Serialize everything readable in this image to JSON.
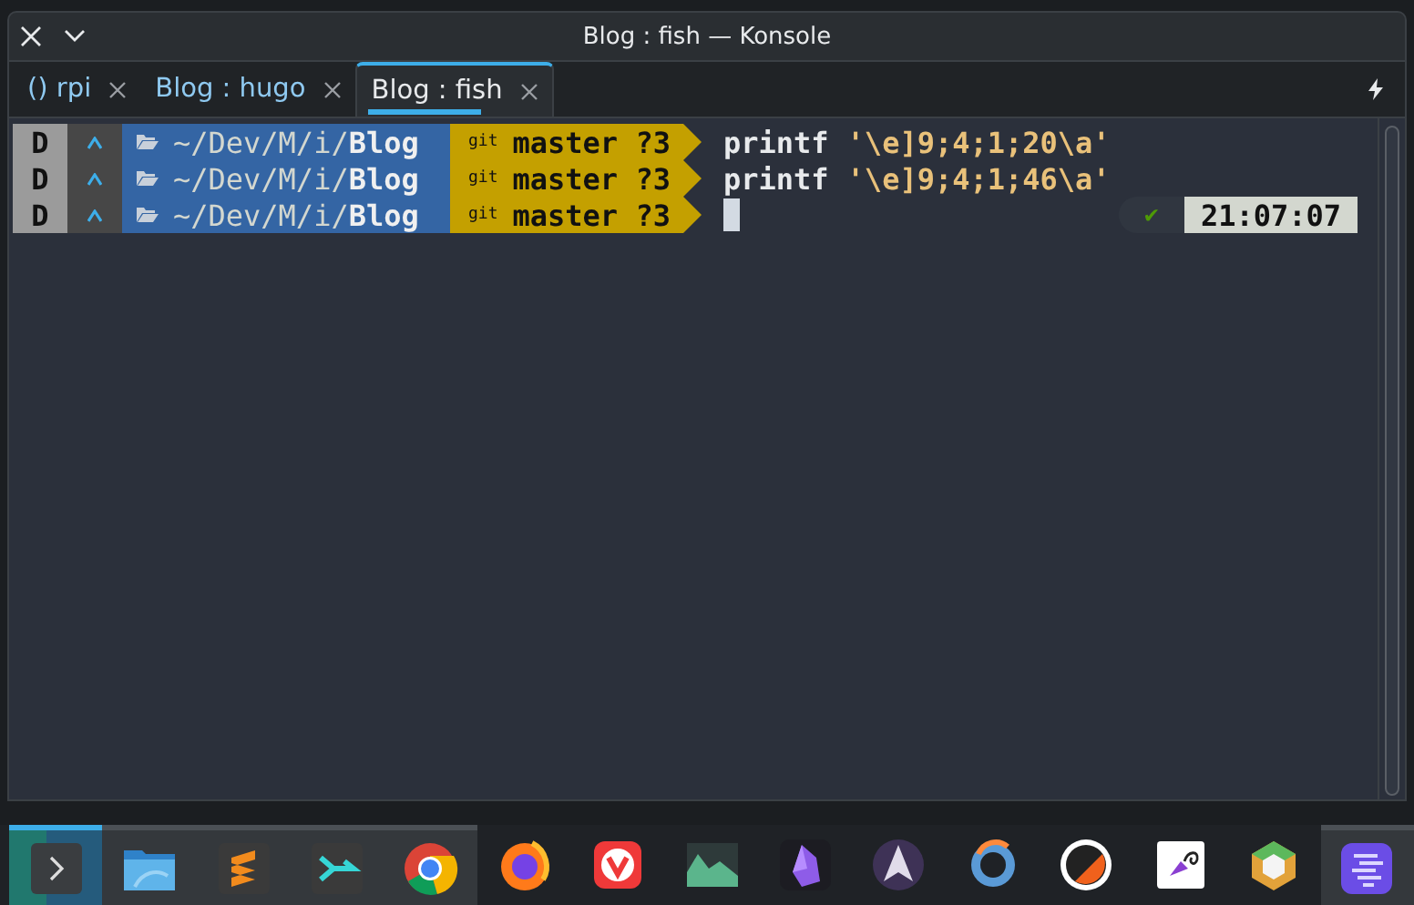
{
  "window": {
    "title": "Blog : fish — Konsole"
  },
  "tabs": [
    {
      "label": "() rpi",
      "selected": false
    },
    {
      "label": "Blog : hugo",
      "selected": false
    },
    {
      "label": "Blog : fish",
      "selected": true
    }
  ],
  "prompt_lines": [
    {
      "status": "D",
      "path": "~/Dev/M/i/**Blog**",
      "vcs": "git",
      "branch": "master ?3",
      "command": "printf",
      "argument": "'\\e]9;4;1;20\\a'",
      "cursor": false
    },
    {
      "status": "D",
      "path": "~/Dev/M/i/**Blog**",
      "vcs": "git",
      "branch": "master ?3",
      "command": "printf",
      "argument": "'\\e]9;4;1;46\\a'",
      "cursor": false
    },
    {
      "status": "D",
      "path": "~/Dev/M/i/**Blog**",
      "vcs": "git",
      "branch": "master ?3",
      "cursor": true,
      "right_prompt": {
        "ok_mark": "✔",
        "time": "21:07:07"
      }
    }
  ],
  "taskbar": [
    {
      "selected": true,
      "running": true
    },
    {
      "selected": false,
      "running": true
    },
    {
      "selected": false,
      "running": true
    },
    {
      "selected": false,
      "running": true
    },
    {
      "selected": false,
      "running": true
    },
    {
      "selected": false,
      "running": false
    },
    {
      "selected": false,
      "running": false
    },
    {
      "selected": false,
      "running": false
    },
    {
      "selected": false,
      "running": false
    },
    {
      "selected": false,
      "running": false
    },
    {
      "selected": false,
      "running": false
    },
    {
      "selected": false,
      "running": false
    },
    {
      "selected": false,
      "running": false
    },
    {
      "selected": false,
      "running": false
    },
    {
      "selected": false,
      "running": true
    }
  ]
}
